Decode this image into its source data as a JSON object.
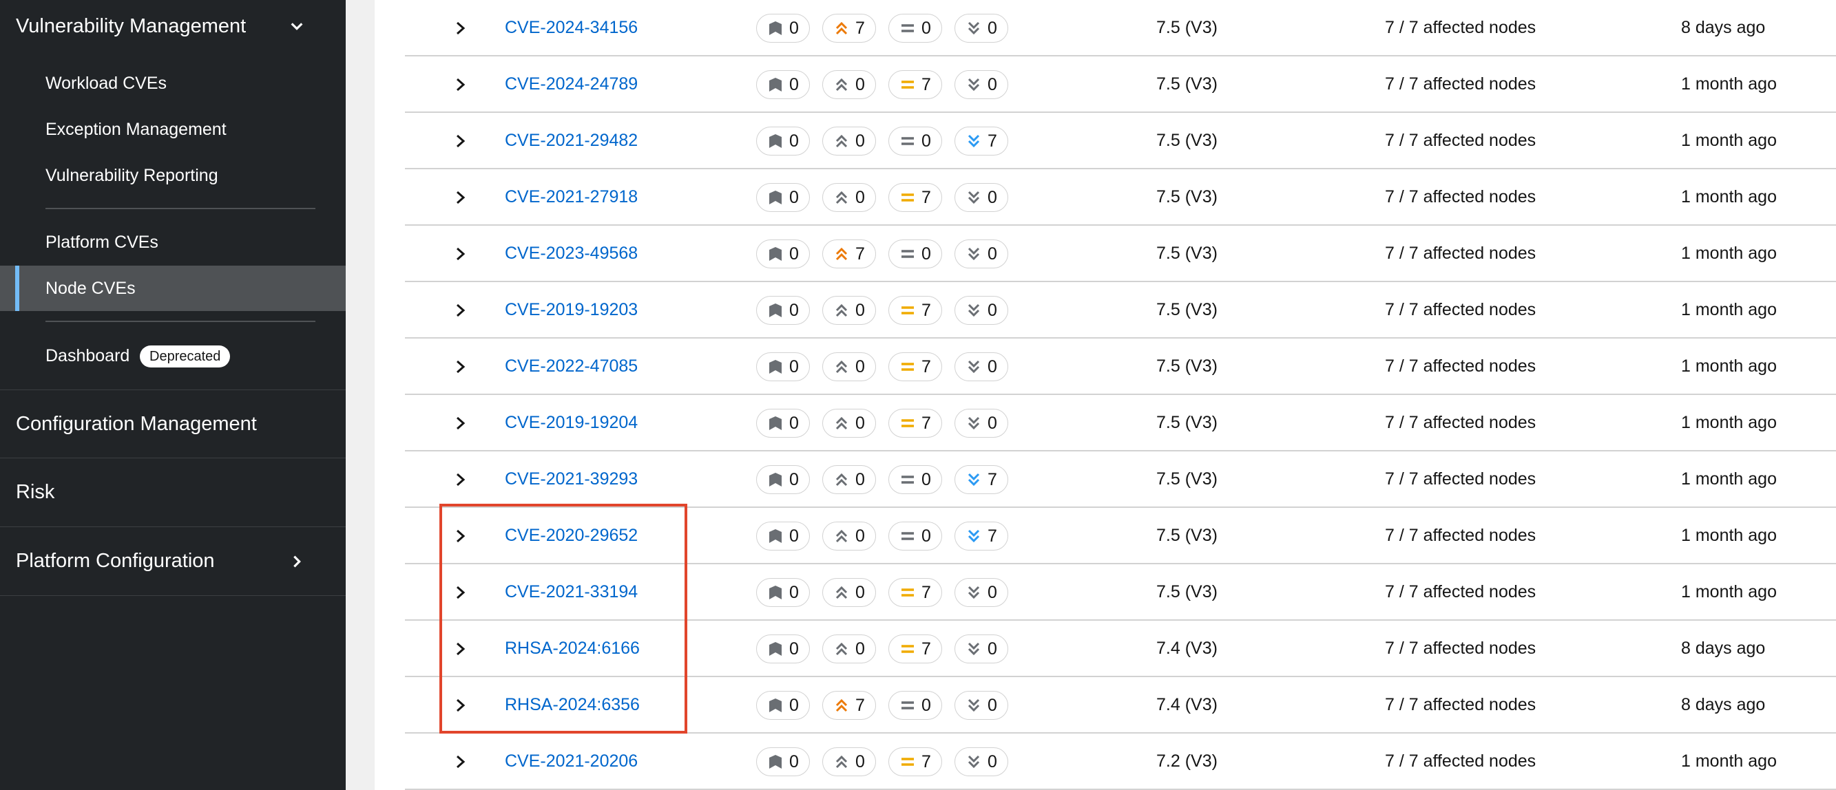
{
  "sidebar": {
    "vuln_mgmt": "Vulnerability Management",
    "items": {
      "workload_cves": "Workload CVEs",
      "exception_mgmt": "Exception Management",
      "vuln_reporting": "Vulnerability Reporting",
      "platform_cves": "Platform CVEs",
      "node_cves": "Node CVEs",
      "dashboard": "Dashboard",
      "deprecated_badge": "Deprecated"
    },
    "config_mgmt": "Configuration Management",
    "risk": "Risk",
    "platform_config": "Platform Configuration"
  },
  "colors": {
    "link": "#0066cc",
    "important": "#ec7a08",
    "moderate": "#f0ab00",
    "low": "#2b9af3",
    "critical": "#6a6e73",
    "highlight": "#e1452c",
    "active_bar": "#73bcf7"
  },
  "icons": {
    "expander": "chevron-right-icon",
    "critical": "critical-severity-icon",
    "important": "important-severity-icon",
    "moderate": "moderate-severity-icon",
    "low": "low-severity-icon"
  },
  "rows": [
    {
      "cve": "CVE-2024-34156",
      "critical": "0",
      "important": "7",
      "moderate": "0",
      "low": "0",
      "cvss": "7.5 (V3)",
      "affected": "7 / 7 affected nodes",
      "discovered": "8 days ago"
    },
    {
      "cve": "CVE-2024-24789",
      "critical": "0",
      "important": "0",
      "moderate": "7",
      "low": "0",
      "cvss": "7.5 (V3)",
      "affected": "7 / 7 affected nodes",
      "discovered": "1 month ago"
    },
    {
      "cve": "CVE-2021-29482",
      "critical": "0",
      "important": "0",
      "moderate": "0",
      "low": "7",
      "cvss": "7.5 (V3)",
      "affected": "7 / 7 affected nodes",
      "discovered": "1 month ago"
    },
    {
      "cve": "CVE-2021-27918",
      "critical": "0",
      "important": "0",
      "moderate": "7",
      "low": "0",
      "cvss": "7.5 (V3)",
      "affected": "7 / 7 affected nodes",
      "discovered": "1 month ago"
    },
    {
      "cve": "CVE-2023-49568",
      "critical": "0",
      "important": "7",
      "moderate": "0",
      "low": "0",
      "cvss": "7.5 (V3)",
      "affected": "7 / 7 affected nodes",
      "discovered": "1 month ago"
    },
    {
      "cve": "CVE-2019-19203",
      "critical": "0",
      "important": "0",
      "moderate": "7",
      "low": "0",
      "cvss": "7.5 (V3)",
      "affected": "7 / 7 affected nodes",
      "discovered": "1 month ago"
    },
    {
      "cve": "CVE-2022-47085",
      "critical": "0",
      "important": "0",
      "moderate": "7",
      "low": "0",
      "cvss": "7.5 (V3)",
      "affected": "7 / 7 affected nodes",
      "discovered": "1 month ago"
    },
    {
      "cve": "CVE-2019-19204",
      "critical": "0",
      "important": "0",
      "moderate": "7",
      "low": "0",
      "cvss": "7.5 (V3)",
      "affected": "7 / 7 affected nodes",
      "discovered": "1 month ago"
    },
    {
      "cve": "CVE-2021-39293",
      "critical": "0",
      "important": "0",
      "moderate": "0",
      "low": "7",
      "cvss": "7.5 (V3)",
      "affected": "7 / 7 affected nodes",
      "discovered": "1 month ago"
    },
    {
      "cve": "CVE-2020-29652",
      "critical": "0",
      "important": "0",
      "moderate": "0",
      "low": "7",
      "cvss": "7.5 (V3)",
      "affected": "7 / 7 affected nodes",
      "discovered": "1 month ago"
    },
    {
      "cve": "CVE-2021-33194",
      "critical": "0",
      "important": "0",
      "moderate": "7",
      "low": "0",
      "cvss": "7.5 (V3)",
      "affected": "7 / 7 affected nodes",
      "discovered": "1 month ago"
    },
    {
      "cve": "RHSA-2024:6166",
      "critical": "0",
      "important": "0",
      "moderate": "7",
      "low": "0",
      "cvss": "7.4 (V3)",
      "affected": "7 / 7 affected nodes",
      "discovered": "8 days ago"
    },
    {
      "cve": "RHSA-2024:6356",
      "critical": "0",
      "important": "7",
      "moderate": "0",
      "low": "0",
      "cvss": "7.4 (V3)",
      "affected": "7 / 7 affected nodes",
      "discovered": "8 days ago"
    },
    {
      "cve": "CVE-2021-20206",
      "critical": "0",
      "important": "0",
      "moderate": "7",
      "low": "0",
      "cvss": "7.2 (V3)",
      "affected": "7 / 7 affected nodes",
      "discovered": "1 month ago"
    }
  ]
}
